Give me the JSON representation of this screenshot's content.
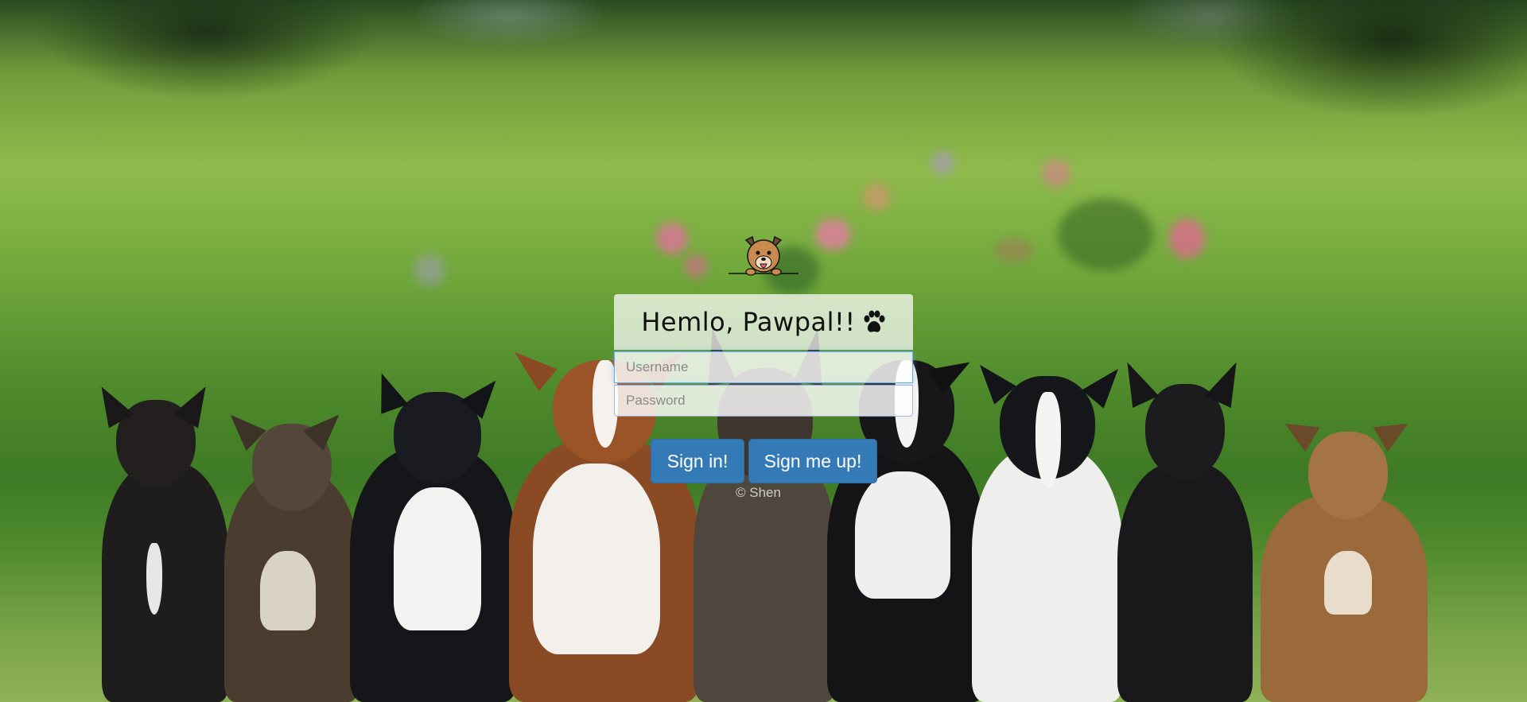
{
  "greeting": {
    "title": "Hemlo, Pawpal!!"
  },
  "form": {
    "username_placeholder": "Username",
    "password_placeholder": "Password",
    "username_value": "",
    "password_value": ""
  },
  "buttons": {
    "sign_in_label": "Sign in!",
    "sign_up_label": "Sign me up!"
  },
  "footer": {
    "copyright": "© Shen"
  },
  "icons": {
    "logo": "dog-face-icon",
    "title_suffix": "paw-print-icon"
  },
  "colors": {
    "primary_button": "#337ab7",
    "primary_button_border": "#2e6da4",
    "focus_ring": "#66afe9",
    "panel_background": "rgba(255,255,255,0.72)"
  }
}
